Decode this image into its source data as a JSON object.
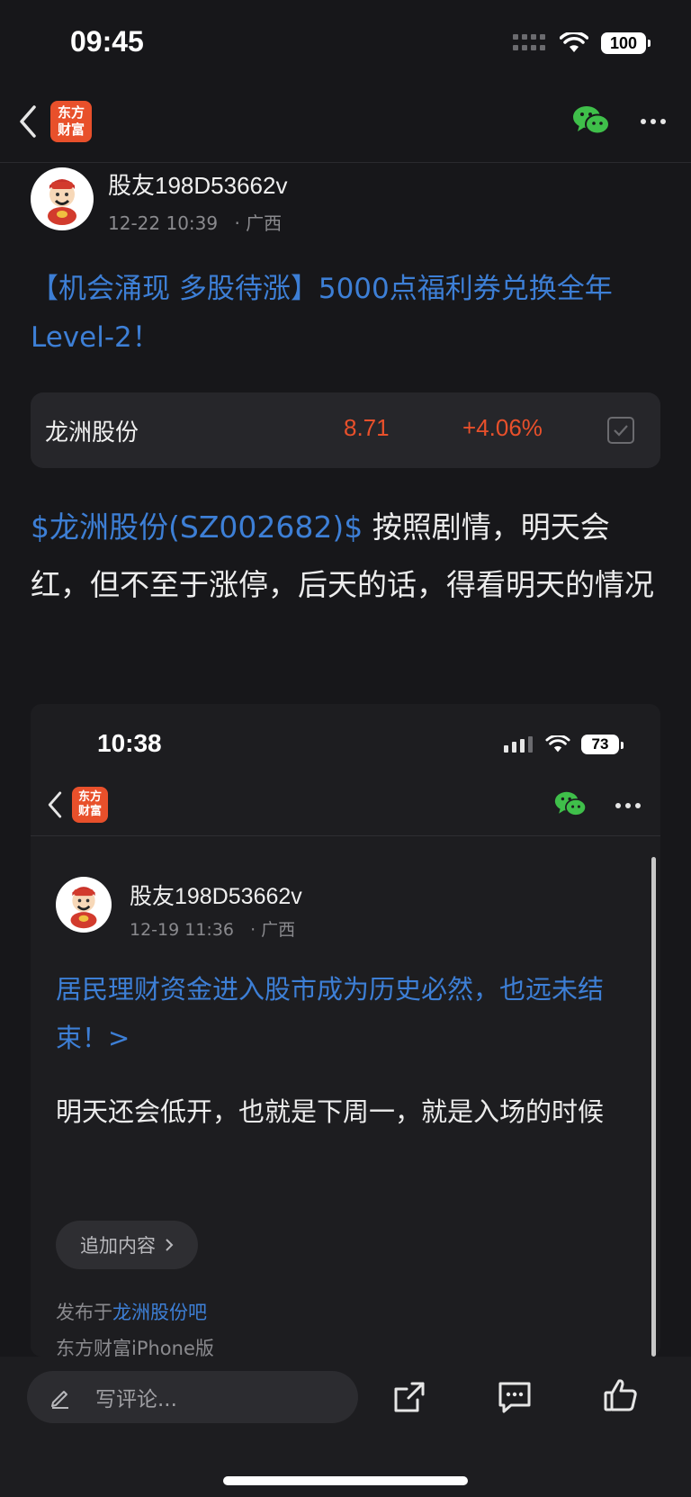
{
  "status": {
    "time": "09:45",
    "battery": "100"
  },
  "nav": {
    "logo_line1": "东方",
    "logo_line2": "财富"
  },
  "post": {
    "username": "股友198D53662v",
    "date": "12-22 10:39",
    "location": "· 广西",
    "title": "【机会涌现 多股待涨】5000点福利券兑换全年Level-2！",
    "stock": {
      "name": "龙洲股份",
      "price": "8.71",
      "change": "+4.06%"
    },
    "body_link": "$龙洲股份(SZ002682)$",
    "body_text": " 按照剧情，明天会红，但不至于涨停，后天的话，得看明天的情况"
  },
  "embedded": {
    "status": {
      "time": "10:38",
      "battery": "73"
    },
    "nav": {
      "logo_line1": "东方",
      "logo_line2": "财富"
    },
    "username": "股友198D53662v",
    "date": "12-19 11:36",
    "location": "· 广西",
    "title": "居民理财资金进入股市成为历史必然，也远未结束！>",
    "body": "明天还会低开，也就是下周一，就是入场的时候",
    "add_content_label": "追加内容",
    "published_prefix": "发布于",
    "published_bar": "龙洲股份吧",
    "client": "东方财富iPhone版"
  },
  "bottom": {
    "comment_placeholder": "写评论..."
  },
  "colors": {
    "link": "#3d7fd6",
    "up": "#e8502b",
    "logo": "#e8502b",
    "wechat": "#3fbf4a"
  }
}
